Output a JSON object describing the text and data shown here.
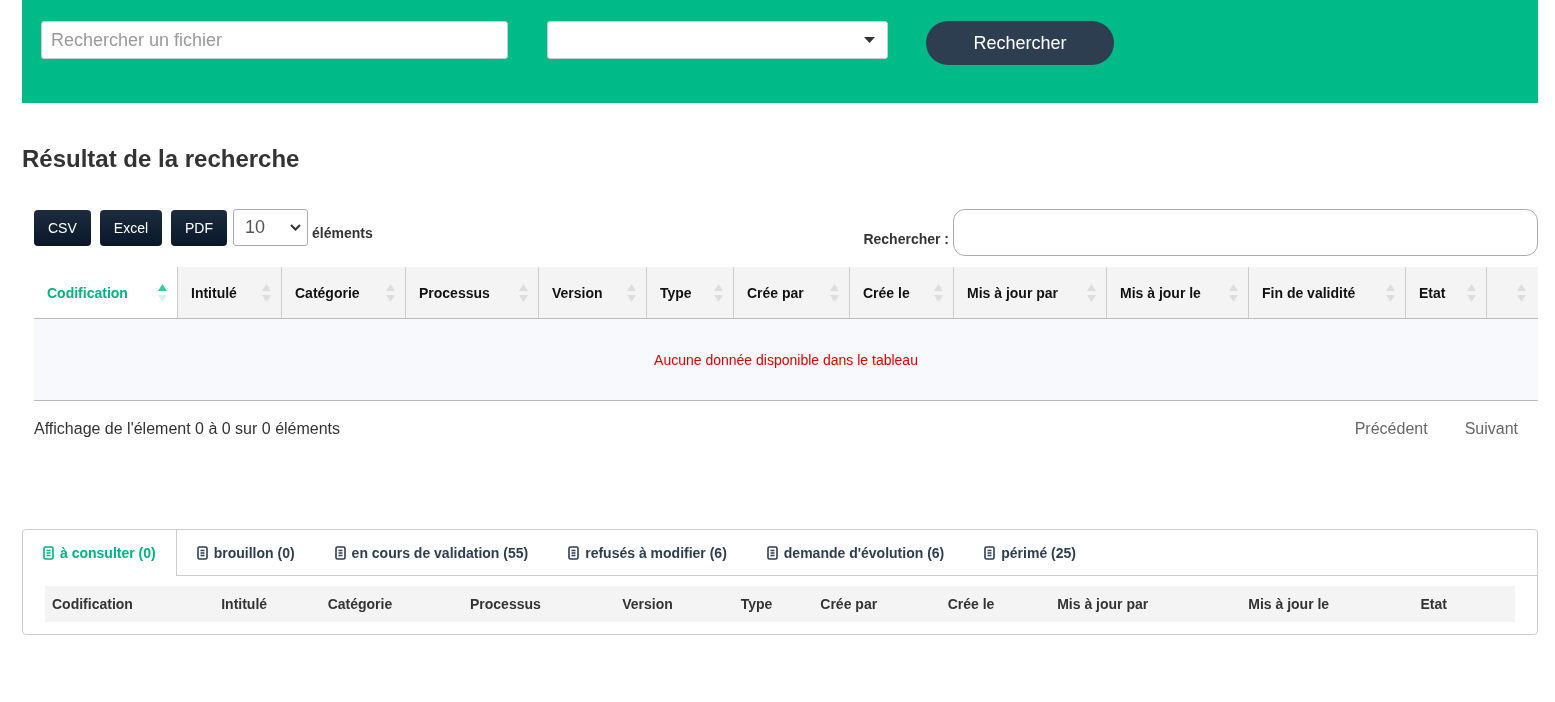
{
  "search_bar": {
    "file_field": {
      "placeholder": "Rechercher un fichier"
    },
    "button": "Rechercher"
  },
  "results": {
    "title": "Résultat de la recherche",
    "export_buttons": [
      "CSV",
      "Excel",
      "PDF"
    ],
    "page_length": {
      "value": "10",
      "label": "éléments"
    },
    "filter": {
      "label": "Rechercher :"
    },
    "table": {
      "columns": [
        {
          "label": "Codification",
          "selected": true
        },
        {
          "label": "Intitulé",
          "selected": false
        },
        {
          "label": "Catégorie",
          "selected": false
        },
        {
          "label": "Processus",
          "selected": false
        },
        {
          "label": "Version",
          "selected": false
        },
        {
          "label": "Type",
          "selected": false
        },
        {
          "label": "Crée par",
          "selected": false
        },
        {
          "label": "Crée le",
          "selected": false
        },
        {
          "label": "Mis à jour par",
          "selected": false
        },
        {
          "label": "Mis à jour le",
          "selected": false
        },
        {
          "label": "Fin de validité",
          "selected": false
        },
        {
          "label": "Etat",
          "selected": false
        },
        {
          "selected": false
        }
      ],
      "empty_message": "Aucune donnée disponible dans le tableau"
    },
    "info": "Affichage de l'élement 0 à 0 sur 0 éléments",
    "pagination": [
      "Précédent",
      "Suivant"
    ]
  },
  "tabs_panel": {
    "tabs": [
      {
        "label": "à consulter (0)",
        "selected": true
      },
      {
        "label": "brouillon (0)",
        "selected": false
      },
      {
        "label": "en cours de validation (55)",
        "selected": false
      },
      {
        "label": "refusés à modifier (6)",
        "selected": false
      },
      {
        "label": "demande d'évolution (6)",
        "selected": false
      },
      {
        "label": "périmé (25)",
        "selected": false
      }
    ],
    "columns": [
      "Codification",
      "Intitulé",
      "Catégorie",
      "Processus",
      "Version",
      "Type",
      "Crée par",
      "Crée le",
      "Mis à jour par",
      "Mis à jour le",
      "Etat"
    ]
  }
}
